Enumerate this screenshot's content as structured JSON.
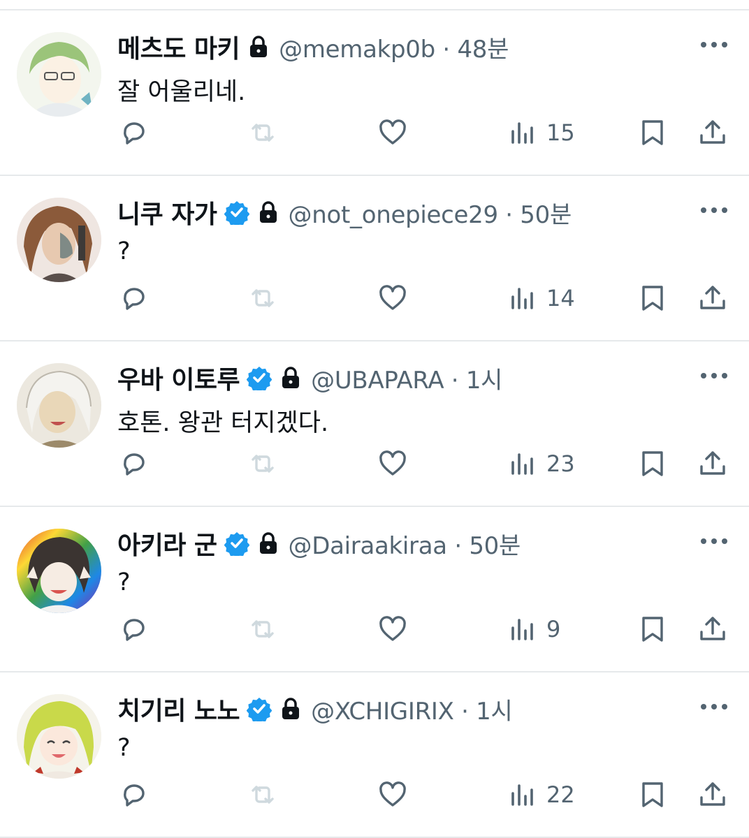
{
  "colors": {
    "text_primary": "#0f1419",
    "text_secondary": "#536471",
    "verified_blue": "#1d9bf0",
    "retweet_disabled": "#cfd9de",
    "divider": "#e6e9eb"
  },
  "icons": {
    "reply": "speech-bubble-icon",
    "retweet": "retweet-arrows-icon",
    "like": "heart-icon",
    "views": "bar-chart-icon",
    "bookmark": "bookmark-icon",
    "share": "share-upload-icon",
    "more": "ellipsis-icon",
    "lock": "lock-icon",
    "verified": "verified-badge-icon"
  },
  "tweets": [
    {
      "display_name": "메츠도 마키",
      "verified": false,
      "protected": true,
      "meta": "@memakp0b · 48분",
      "text": "잘 어울리네.",
      "views": "15"
    },
    {
      "display_name": "니쿠 자가",
      "verified": true,
      "protected": true,
      "meta": "@not_onepiece29 · 50분",
      "text": "?",
      "views": "14"
    },
    {
      "display_name": "우바 이토루",
      "verified": true,
      "protected": true,
      "meta": "@UBAPARA · 1시",
      "text": "호톤. 왕관 터지겠다.",
      "views": "23"
    },
    {
      "display_name": "아키라 군",
      "verified": true,
      "protected": true,
      "meta": "@Dairaakiraa · 50분",
      "text": "?",
      "views": "9"
    },
    {
      "display_name": "치기리 노노",
      "verified": true,
      "protected": true,
      "meta": "@XCHIGIRIX · 1시",
      "text": "?",
      "views": "22"
    }
  ]
}
